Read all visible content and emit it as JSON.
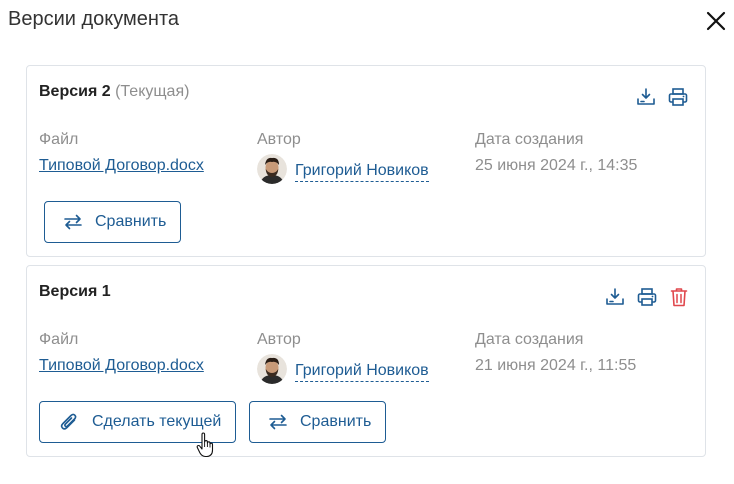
{
  "dialog": {
    "title": "Версии документа"
  },
  "labels": {
    "file": "Файл",
    "author": "Автор",
    "date": "Дата создания"
  },
  "versions": [
    {
      "title": "Версия 2",
      "tag": "(Текущая)",
      "file": "Типовой Договор.docx",
      "author": "Григорий Новиков",
      "date": "25 июня 2024 г., 14:35",
      "compare_label": "Сравнить"
    },
    {
      "title": "Версия 1",
      "file": "Типовой Договор.docx",
      "author": "Григорий Новиков",
      "date": "21 июня 2024 г., 11:55",
      "make_current_label": "Сделать текущей",
      "compare_label": "Сравнить"
    }
  ],
  "colors": {
    "link": "#1e5c93",
    "muted": "#8e8e8e",
    "danger": "#e0474c",
    "border": "#dfe3e8"
  },
  "icons": [
    "close-icon",
    "download-icon",
    "print-icon",
    "trash-icon",
    "swap-arrows-icon",
    "paperclip-icon",
    "hand-cursor-icon"
  ]
}
